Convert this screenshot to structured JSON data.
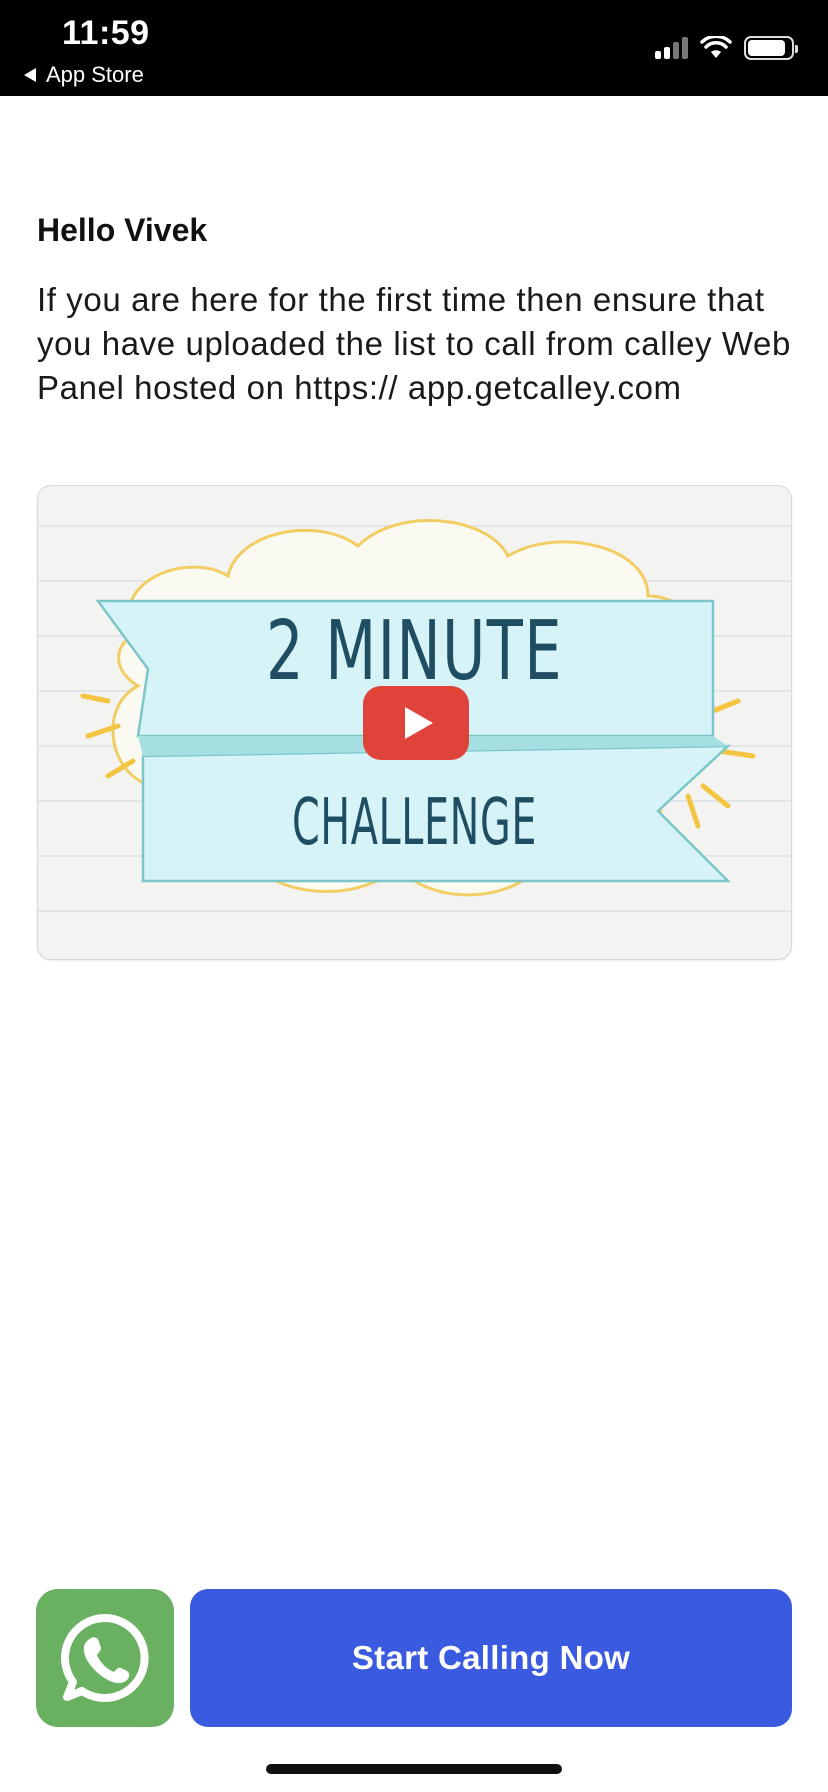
{
  "status_bar": {
    "time": "11:59",
    "back_label": "App Store"
  },
  "content": {
    "greeting": "Hello Vivek",
    "intro": "If you are here for the first time then ensure that you have uploaded the list to call from calley Web Panel hosted on https:// app.getcalley.com"
  },
  "video": {
    "title_line1": "2 MINUTE",
    "title_line2": "CHALLENGE",
    "play_icon": "play-icon",
    "accent": "#e0433a"
  },
  "actions": {
    "whatsapp_icon": "whatsapp-icon",
    "start_calling_label": "Start Calling Now",
    "cta_color": "#3a5be0"
  }
}
